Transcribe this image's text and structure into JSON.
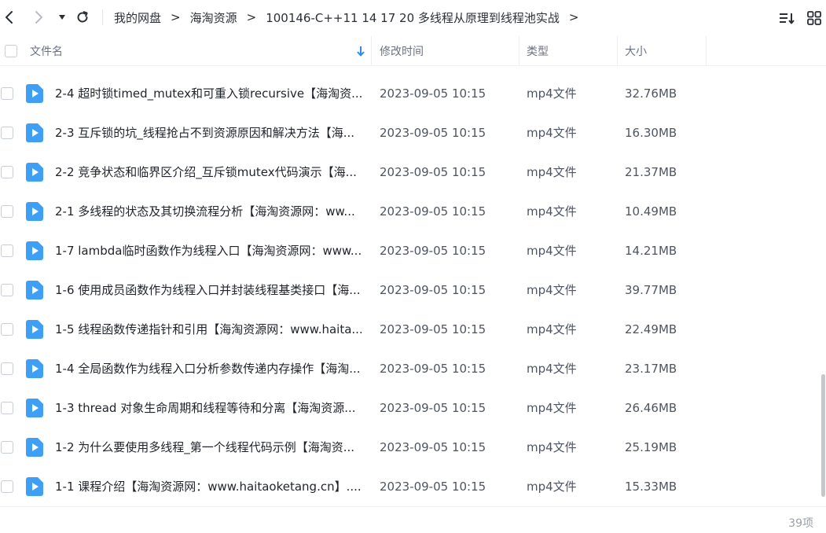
{
  "toolbar": {
    "breadcrumb": [
      "我的网盘",
      "海淘资源",
      "100146-C++11 14 17 20 多线程从原理到线程池实战"
    ],
    "separator": ">"
  },
  "table": {
    "columns": {
      "name": "文件名",
      "modified": "修改时间",
      "type": "类型",
      "size": "大小"
    },
    "rows": [
      {
        "name": "2-4 超时锁timed_mutex和可重入锁recursive【海淘资...",
        "modified": "2023-09-05 10:15",
        "type": "mp4文件",
        "size": "32.76MB"
      },
      {
        "name": "2-3 互斥锁的坑_线程抢占不到资源原因和解决方法【海...",
        "modified": "2023-09-05 10:15",
        "type": "mp4文件",
        "size": "16.30MB"
      },
      {
        "name": "2-2 竞争状态和临界区介绍_互斥锁mutex代码演示【海...",
        "modified": "2023-09-05 10:15",
        "type": "mp4文件",
        "size": "21.37MB"
      },
      {
        "name": "2-1 多线程的状态及其切换流程分析【海淘资源网：ww...",
        "modified": "2023-09-05 10:15",
        "type": "mp4文件",
        "size": "10.49MB"
      },
      {
        "name": "1-7 lambda临时函数作为线程入口【海淘资源网：www....",
        "modified": "2023-09-05 10:15",
        "type": "mp4文件",
        "size": "14.21MB"
      },
      {
        "name": "1-6 使用成员函数作为线程入口并封装线程基类接口【海...",
        "modified": "2023-09-05 10:15",
        "type": "mp4文件",
        "size": "39.77MB"
      },
      {
        "name": "1-5 线程函数传递指针和引用【海淘资源网：www.haita...",
        "modified": "2023-09-05 10:15",
        "type": "mp4文件",
        "size": "22.49MB"
      },
      {
        "name": "1-4 全局函数作为线程入口分析参数传递内存操作【海淘...",
        "modified": "2023-09-05 10:15",
        "type": "mp4文件",
        "size": "23.17MB"
      },
      {
        "name": "1-3 thread 对象生命周期和线程等待和分离【海淘资源...",
        "modified": "2023-09-05 10:15",
        "type": "mp4文件",
        "size": "26.46MB"
      },
      {
        "name": "1-2 为什么要使用多线程_第一个线程代码示例【海淘资...",
        "modified": "2023-09-05 10:15",
        "type": "mp4文件",
        "size": "25.19MB"
      },
      {
        "name": "1-1 课程介绍【海淘资源网：www.haitaoketang.cn】....",
        "modified": "2023-09-05 10:15",
        "type": "mp4文件",
        "size": "15.33MB"
      }
    ]
  },
  "footer": {
    "count": "39项"
  },
  "colors": {
    "accent": "#2e8cf0",
    "video_icon": "#3f9ff5"
  },
  "icons": {
    "back": "chevron-left-icon",
    "forward": "chevron-right-icon",
    "history": "caret-down-icon",
    "refresh": "refresh-icon",
    "sort_menu": "sort-list-icon",
    "view_mode": "grid-view-icon",
    "file": "video-file-icon",
    "sort_direction": "arrow-down-icon"
  }
}
